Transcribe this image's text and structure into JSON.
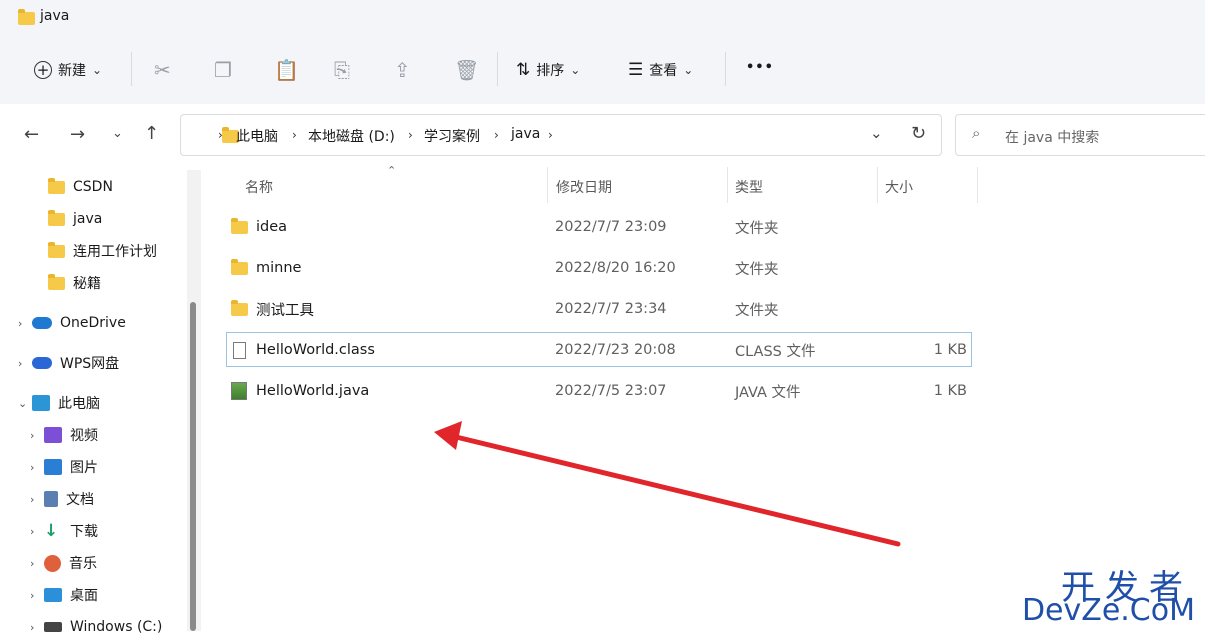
{
  "window": {
    "title": "java"
  },
  "toolbar": {
    "new_label": "新建",
    "sort_label": "排序",
    "view_label": "查看",
    "more_label": "•••"
  },
  "nav": {
    "breadcrumbs": [
      "此电脑",
      "本地磁盘 (D:)",
      "学习案例",
      "java"
    ]
  },
  "search": {
    "placeholder": "在 java 中搜索"
  },
  "sidebar": {
    "pinned": [
      {
        "label": "CSDN"
      },
      {
        "label": "java"
      },
      {
        "label": "连用工作计划"
      },
      {
        "label": "秘籍"
      }
    ],
    "onedrive": "OneDrive",
    "wps": "WPS网盘",
    "thispc": "此电脑",
    "pc_items": [
      {
        "label": "视频",
        "color": "#7b4fd6"
      },
      {
        "label": "图片",
        "color": "#2a7fd4"
      },
      {
        "label": "文档",
        "color": "#5a7fb0"
      },
      {
        "label": "下载",
        "color": "#1f9f6b"
      },
      {
        "label": "音乐",
        "color": "#e0603c"
      },
      {
        "label": "桌面",
        "color": "#2b8fd9"
      },
      {
        "label": "Windows (C:)",
        "color": "#444444"
      }
    ]
  },
  "columns": {
    "name": "名称",
    "modified": "修改日期",
    "type": "类型",
    "size": "大小"
  },
  "files": [
    {
      "name": "idea",
      "modified": "2022/7/7 23:09",
      "type": "文件夹",
      "size": ""
    },
    {
      "name": "minne",
      "modified": "2022/8/20 16:20",
      "type": "文件夹",
      "size": ""
    },
    {
      "name": "测试工具",
      "modified": "2022/7/7 23:34",
      "type": "文件夹",
      "size": ""
    },
    {
      "name": "HelloWorld.class",
      "modified": "2022/7/23 20:08",
      "type": "CLASS 文件",
      "size": "1 KB"
    },
    {
      "name": "HelloWorld.java",
      "modified": "2022/7/5 23:07",
      "type": "JAVA 文件",
      "size": "1 KB"
    }
  ],
  "watermark": {
    "line1": "开发者",
    "line2": "DevZe.CoM"
  },
  "colors": {
    "annotation_arrow": "#e0262b",
    "folder": "#f7c948",
    "selection": "#99c4e6"
  }
}
